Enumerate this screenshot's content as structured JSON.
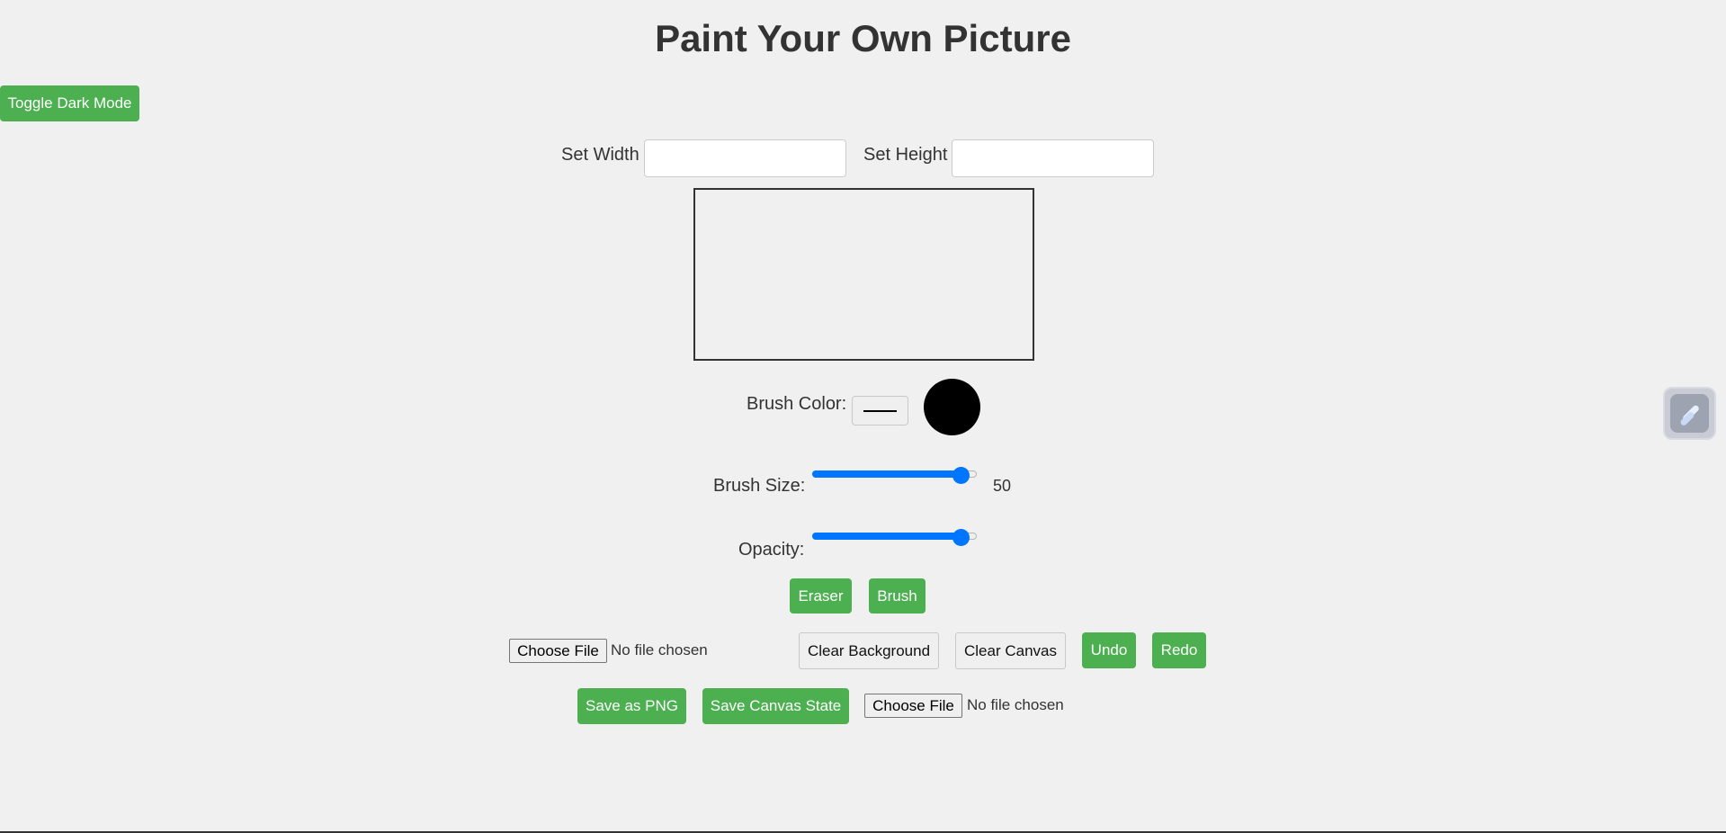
{
  "page": {
    "title": "Paint Your Own Picture",
    "background_color": "#f0f0f0",
    "accent_color": "#4caf50"
  },
  "toolbar": {
    "dark_mode_label": "Toggle Dark Mode"
  },
  "dimensions": {
    "width_label": "Set Width",
    "width_value": "",
    "height_label": "Set Height",
    "height_value": ""
  },
  "brush": {
    "color_label": "Brush Color:",
    "color_value": "#000000",
    "size_label": "Brush Size:",
    "size_value": "50",
    "size_fraction": 0.9,
    "opacity_label": "Opacity:",
    "opacity_fraction": 0.9
  },
  "tools": {
    "eraser_label": "Eraser",
    "brush_label": "Brush"
  },
  "actions": {
    "choose_file_label": "Choose File",
    "no_file_text": "No file chosen",
    "clear_background_label": "Clear Background",
    "clear_canvas_label": "Clear Canvas",
    "undo_label": "Undo",
    "redo_label": "Redo",
    "save_png_label": "Save as PNG",
    "save_state_label": "Save Canvas State",
    "load_state_choose_label": "Choose File",
    "load_state_no_file_text": "No file chosen"
  },
  "side_widget": {
    "icon": "extension-icon"
  }
}
